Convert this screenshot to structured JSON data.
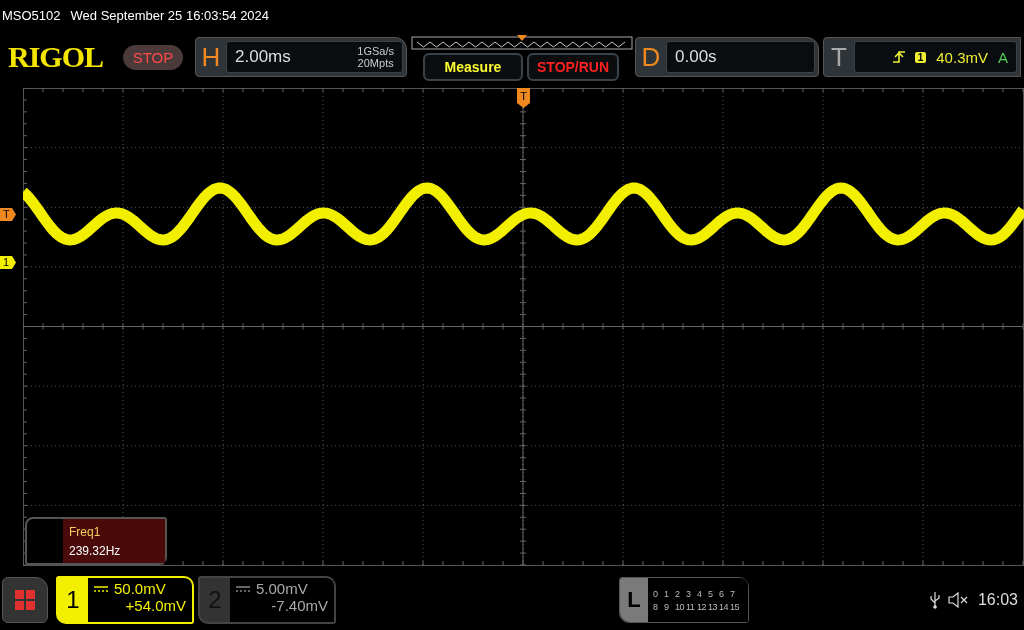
{
  "title_bar": {
    "model": "MSO5102",
    "datetime": "Wed September 25 16:03:54 2024"
  },
  "logo": "RIGOL",
  "run_status": "STOP",
  "horizontal": {
    "label": "H",
    "timebase": "2.00ms",
    "sample_rate": "1GSa/s",
    "memory_depth": "20Mpts"
  },
  "buttons": [
    {
      "label": "Measure",
      "kind": "measure"
    },
    {
      "label": "STOP/RUN",
      "kind": "stoprun"
    }
  ],
  "delay": {
    "label": "D",
    "value": "0.00s"
  },
  "trigger": {
    "label": "T",
    "source": "1",
    "level": "40.3mV",
    "mode": "A"
  },
  "trigger_position_marker": "T",
  "trigger_level_marker": "T",
  "channel_marker": "1",
  "measurement": {
    "name": "Freq1",
    "value": "239.32Hz"
  },
  "channels": [
    {
      "number": "1",
      "scale": "50.0mV",
      "offset": "+54.0mV",
      "selected": true
    },
    {
      "number": "2",
      "scale": "5.00mV",
      "offset": "-7.40mV",
      "selected": false
    }
  ],
  "logic": {
    "label": "L",
    "rows": [
      [
        "0",
        "1",
        "2",
        "3",
        "4",
        "5",
        "6",
        "7"
      ],
      [
        "8",
        "9",
        "10",
        "11",
        "12",
        "13",
        "14",
        "15"
      ]
    ]
  },
  "status": {
    "muted": true,
    "time": "16:03"
  }
}
